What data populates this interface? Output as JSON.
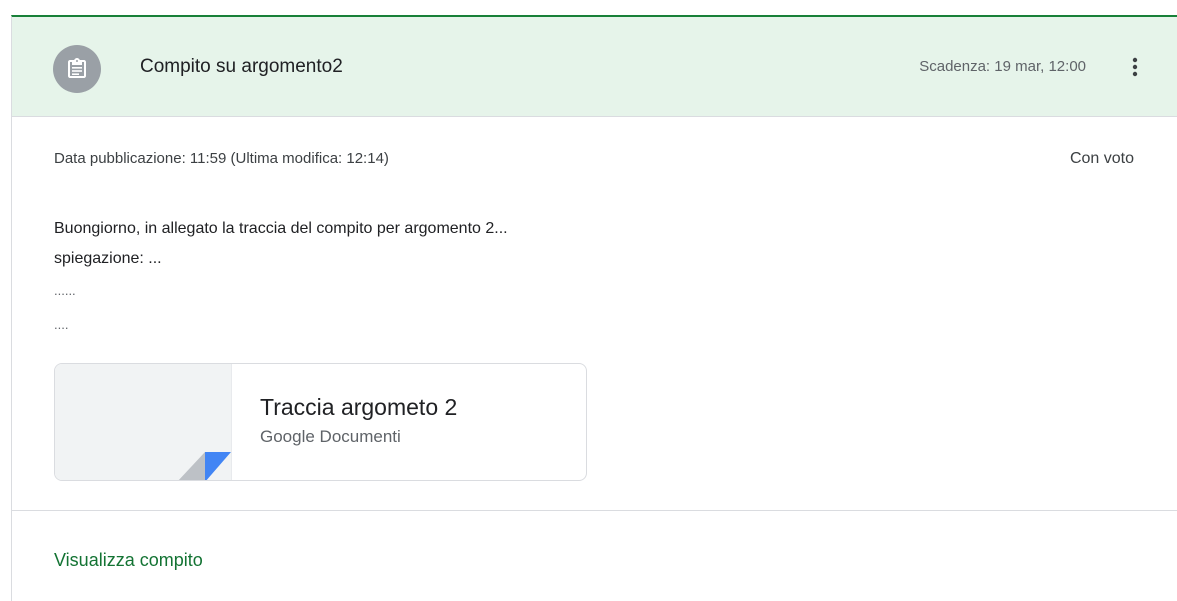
{
  "assignment": {
    "icon": "assignment-icon",
    "title": "Compito su argomento2",
    "due": "Scadenza: 19 mar, 12:00",
    "menu_icon": "more-vert-icon"
  },
  "meta": {
    "published": "Data pubblicazione: 11:59 (Ultima modifica: 12:14)",
    "grade": "Con voto"
  },
  "description": {
    "lines": [
      "Buongiorno, in allegato la traccia del compito per argomento 2...",
      "spiegazione: ...",
      "......",
      "...."
    ]
  },
  "attachment": {
    "title": "Traccia argometo 2",
    "type": "Google Documenti",
    "icon": "google-docs-thumbnail-icon"
  },
  "footer": {
    "link": "Visualizza compito"
  },
  "colors": {
    "accent": "#188038",
    "header_bg": "#e6f4ea",
    "link": "#137333",
    "docs_blue": "#4285f4"
  }
}
